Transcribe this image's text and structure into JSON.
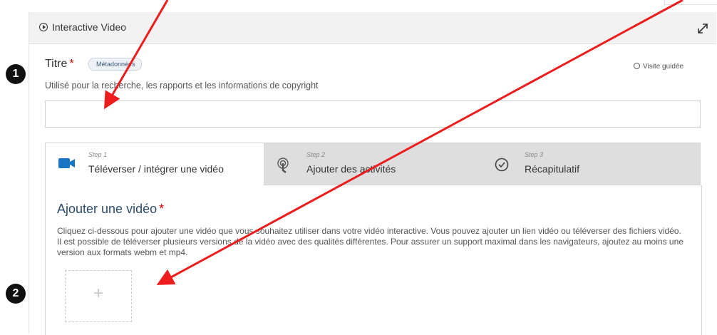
{
  "header": {
    "title": "Interactive Video",
    "icon": "play-circle-icon",
    "expand_icon": "expand-icon"
  },
  "title_field": {
    "label": "Titre",
    "required_mark": "*",
    "badge": "Métadonnées",
    "description": "Utilisé pour la recherche, les rapports et les informations de copyright",
    "value": ""
  },
  "guided_tour": {
    "label": "Visite guidée"
  },
  "steps": [
    {
      "step": "Step 1",
      "label": "Téléverser / intégrer une vidéo",
      "icon": "video-camera-icon",
      "active": true
    },
    {
      "step": "Step 2",
      "label": "Ajouter des activités",
      "icon": "touch-icon",
      "active": false
    },
    {
      "step": "Step 3",
      "label": "Récapitulatif",
      "icon": "check-circle-icon",
      "active": false
    }
  ],
  "content": {
    "title": "Ajouter une vidéo",
    "required_mark": "*",
    "description": "Cliquez ci-dessous pour ajouter une vidéo que vous souhaitez utiliser dans votre vidéo interactive. Vous pouvez ajouter un lien vidéo ou téléverser des fichiers vidéo. Il est possible de téléverser plusieurs versions de la vidéo avec des qualités différentes. Pour assurer un support maximal dans les navigateurs, ajoutez au moins une version aux formats webm et mp4.",
    "add_button": "+"
  },
  "markers": [
    "1",
    "2"
  ],
  "colors": {
    "accent": "#1a74c4",
    "heading": "#2c4c6e",
    "required": "#cc0000",
    "arrow": "#ee1c1c"
  }
}
